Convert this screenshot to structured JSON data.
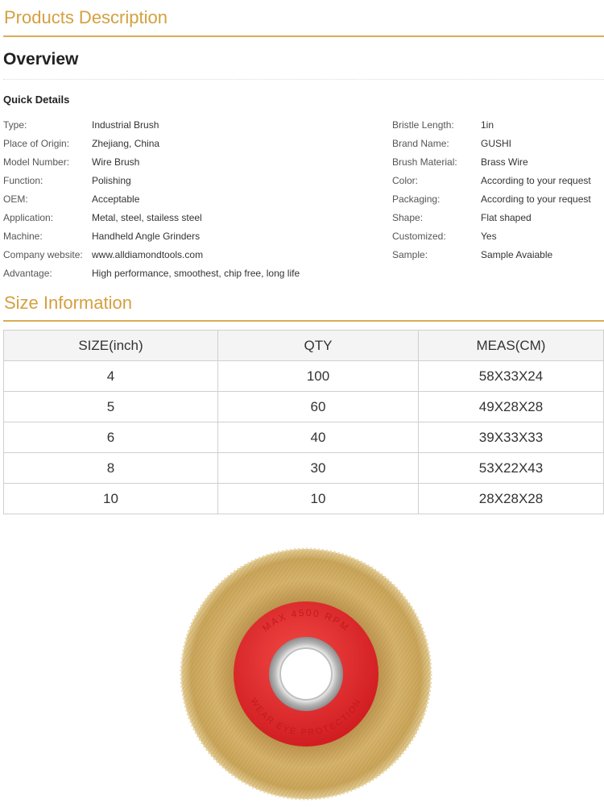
{
  "headers": {
    "products_description": "Products Description",
    "overview": "Overview",
    "quick_details": "Quick Details",
    "size_information": "Size Information"
  },
  "quick_details_left": [
    {
      "label": "Type:",
      "value": "Industrial Brush"
    },
    {
      "label": "Place of Origin:",
      "value": "Zhejiang, China"
    },
    {
      "label": "Model Number:",
      "value": "Wire Brush"
    },
    {
      "label": "Function:",
      "value": "Polishing"
    },
    {
      "label": "OEM:",
      "value": "Acceptable"
    },
    {
      "label": "Application:",
      "value": "Metal, steel, stailess steel"
    },
    {
      "label": "Machine:",
      "value": "Handheld Angle Grinders"
    },
    {
      "label": "Company website:",
      "value": "www.alldiamondtools.com"
    },
    {
      "label": "Advantage:",
      "value": "High performance, smoothest, chip free, long life"
    }
  ],
  "quick_details_right": [
    {
      "label": "Bristle Length:",
      "value": "1in"
    },
    {
      "label": "Brand Name:",
      "value": "GUSHI"
    },
    {
      "label": "Brush Material:",
      "value": "Brass Wire"
    },
    {
      "label": "Color:",
      "value": "According to your request"
    },
    {
      "label": "Packaging:",
      "value": "According to your request"
    },
    {
      "label": "Shape:",
      "value": "Flat shaped"
    },
    {
      "label": "Customized:",
      "value": "Yes"
    },
    {
      "label": "Sample:",
      "value": "Sample Avaiable"
    }
  ],
  "size_table": {
    "columns": [
      "SIZE(inch)",
      "QTY",
      "MEAS(CM)"
    ],
    "rows": [
      [
        "4",
        "100",
        "58X33X24"
      ],
      [
        "5",
        "60",
        "49X28X28"
      ],
      [
        "6",
        "40",
        "39X33X33"
      ],
      [
        "8",
        "30",
        "53X22X43"
      ],
      [
        "10",
        "10",
        "28X28X28"
      ]
    ]
  },
  "product_image": {
    "hub_text_top": "MAX 4500 RPM",
    "hub_text_bottom": "WEAR EYE PROTECTION",
    "colors": {
      "bristles": "#c9a55a",
      "hub": "#e8262a",
      "center": "#c8c8c8"
    }
  },
  "theme": {
    "accent": "#d4a03f",
    "accent_line": "#d9ad55"
  }
}
